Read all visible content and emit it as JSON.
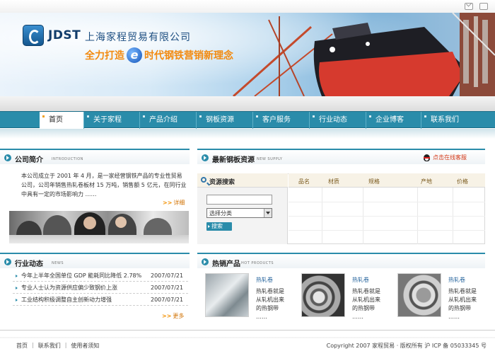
{
  "header": {
    "logo_text": "JDST",
    "company_name": "上海家程贸易有限公司",
    "slogan_before": "全力打造",
    "slogan_mark": "e",
    "slogan_after": "时代钢铁营销新理念"
  },
  "nav": {
    "items": [
      {
        "label": "首页"
      },
      {
        "label": "关于家程"
      },
      {
        "label": "产品介绍"
      },
      {
        "label": "钢板资源"
      },
      {
        "label": "客户服务"
      },
      {
        "label": "行业动态"
      },
      {
        "label": "企业博客"
      },
      {
        "label": "联系我们"
      }
    ]
  },
  "about": {
    "title": "公司简介",
    "subtitle": "INTRODUCTION",
    "text": "本公司成立于 2001 年 4 月，是一家经营钢铁产品的专业性贸易公司，公司年销售热轧卷板材 15 万吨，销售额 5 亿元，在同行业中具有一定的市场影响力 ……",
    "more": "详细"
  },
  "supply": {
    "title": "最新钢板资源",
    "subtitle": "NEW SUPPLY",
    "online_service": "点击在线客服",
    "search_title": "资源搜索",
    "keyword_value": "",
    "category_selected": "选择分类",
    "search_button": "搜索",
    "columns": [
      "品名",
      "材质",
      "规格",
      "产地",
      "价格"
    ]
  },
  "news": {
    "title": "行业动态",
    "subtitle": "NEWS",
    "items": [
      {
        "title": "今年上半年全国单位 GDP 能耗同比降低 2.78%",
        "date": "2007/07/21"
      },
      {
        "title": "专业人士认为资源供应偏少致钢价上涨",
        "date": "2007/07/21"
      },
      {
        "title": "工业结构积极调整自主创新动力增强",
        "date": "2007/07/21"
      }
    ],
    "more": "更多"
  },
  "hot": {
    "title": "热销产品",
    "subtitle": "HOT PRODUCTS",
    "products": [
      {
        "name": "热轧卷",
        "desc": "热轧卷就是从轧机出来的热钢带 ……"
      },
      {
        "name": "热轧卷",
        "desc": "热轧卷就是从轧机出来的热钢带 ……"
      },
      {
        "name": "热轧卷",
        "desc": "热轧卷就是从轧机出来的热钢带 ……"
      }
    ]
  },
  "footer": {
    "links": [
      "首页",
      "联系我们",
      "使用者须知"
    ],
    "copyright": "Copyright 2007 家程贸易 · 版权所有  沪 ICP 备 05033345 号"
  },
  "colors": {
    "primary": "#2a8caa",
    "accent": "#f28a10",
    "link": "#1f5f9a"
  },
  "icons": [
    "mail-icon",
    "favorite-icon",
    "search-icon",
    "qq-icon",
    "arrow-icon"
  ]
}
